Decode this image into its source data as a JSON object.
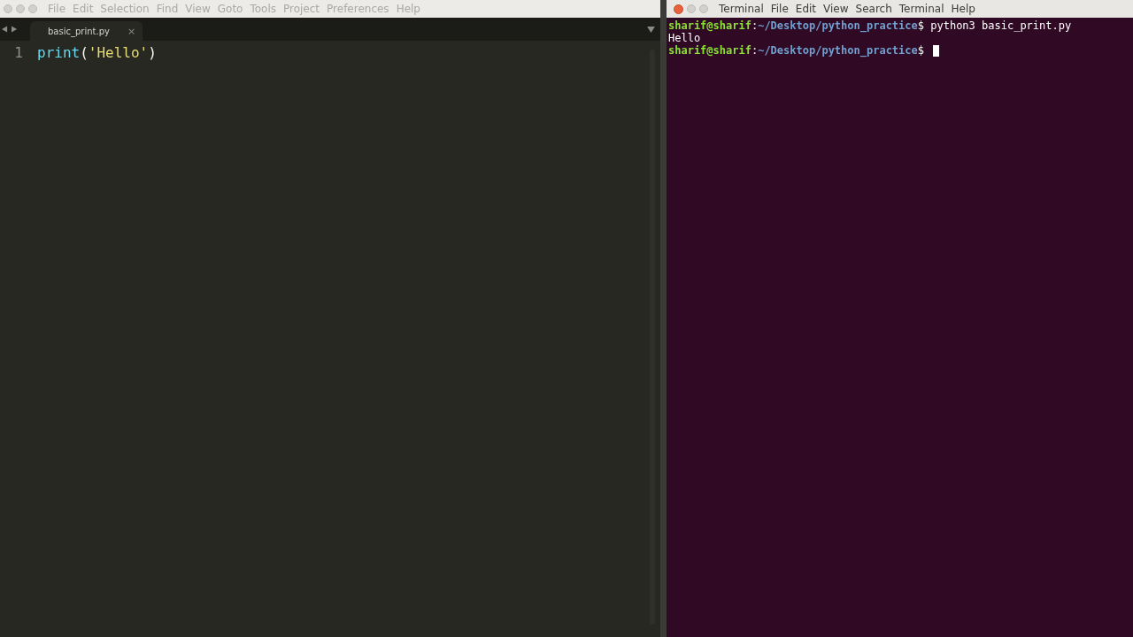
{
  "editor": {
    "focused": false,
    "menu": [
      "File",
      "Edit",
      "Selection",
      "Find",
      "View",
      "Goto",
      "Tools",
      "Project",
      "Preferences",
      "Help"
    ],
    "tabs": [
      {
        "label": "basic_print.py",
        "selected": true,
        "close": "×"
      }
    ],
    "lines": [
      {
        "number": "1",
        "tokens": [
          {
            "kind": "function",
            "text": "print"
          },
          {
            "kind": "punct",
            "text": "("
          },
          {
            "kind": "string",
            "text": "'Hello'"
          },
          {
            "kind": "punct",
            "text": ")"
          }
        ]
      }
    ]
  },
  "terminal": {
    "focused": true,
    "menu": [
      "Terminal",
      "File",
      "Edit",
      "View",
      "Search",
      "Terminal",
      "Help"
    ],
    "lines": [
      {
        "cursor": false,
        "segments": [
          {
            "kind": "user",
            "text": "sharif@sharif"
          },
          {
            "kind": "plain",
            "text": ":"
          },
          {
            "kind": "path",
            "text": "~/Desktop/python_practice"
          },
          {
            "kind": "plain",
            "text": "$ python3 basic_print.py"
          }
        ]
      },
      {
        "cursor": false,
        "segments": [
          {
            "kind": "plain",
            "text": "Hello"
          }
        ]
      },
      {
        "cursor": true,
        "segments": [
          {
            "kind": "user",
            "text": "sharif@sharif"
          },
          {
            "kind": "plain",
            "text": ":"
          },
          {
            "kind": "path",
            "text": "~/Desktop/python_practice"
          },
          {
            "kind": "plain",
            "text": "$ "
          }
        ]
      }
    ]
  }
}
